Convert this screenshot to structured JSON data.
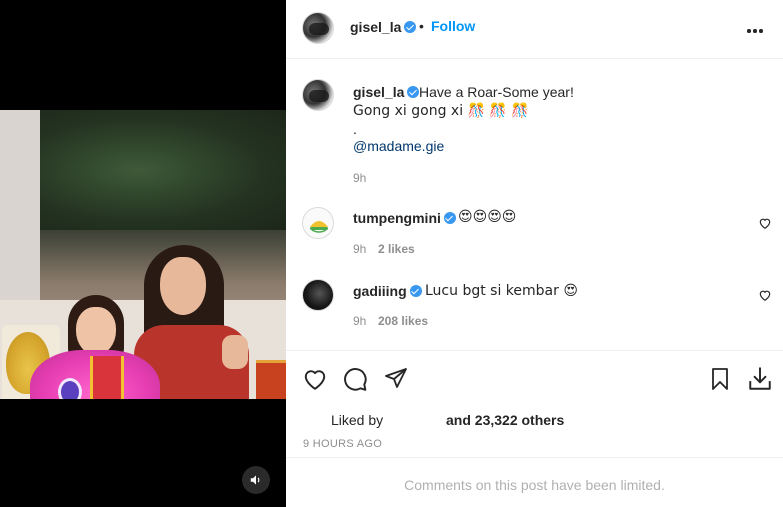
{
  "post": {
    "author": "gisel_la",
    "follow_label": "Follow",
    "separator": "•"
  },
  "caption": {
    "author": "gisel_la",
    "line1": "Have a Roar-Some year!",
    "line2": "Gong xi gong xi 🎊 🎊 🎊",
    "line3": ".",
    "mention": "@madame.gie",
    "time": "9h"
  },
  "comments": [
    {
      "user": "tumpengmini",
      "text": "😍😍😍😍",
      "time": "9h",
      "likes": "2 likes"
    },
    {
      "user": "gadiiing",
      "text": "Lucu bgt si kembar 😍",
      "time": "9h",
      "likes": "208 likes"
    }
  ],
  "likes": {
    "liked_by_label": "Liked by",
    "others": "and 23,322 others"
  },
  "timestamp": "9 HOURS AGO",
  "comments_limited": "Comments on this post have been limited.",
  "icons": {
    "like": "heart-icon",
    "comment": "comment-icon",
    "share": "paper-plane-icon",
    "save": "bookmark-icon",
    "download": "download-icon",
    "more": "more-options-icon",
    "sound": "speaker-icon",
    "verified": "verified-badge-icon"
  },
  "colors": {
    "link": "#0095f6",
    "mention": "#00376b",
    "muted": "#8e8e8e",
    "verified": "#3897f0"
  }
}
